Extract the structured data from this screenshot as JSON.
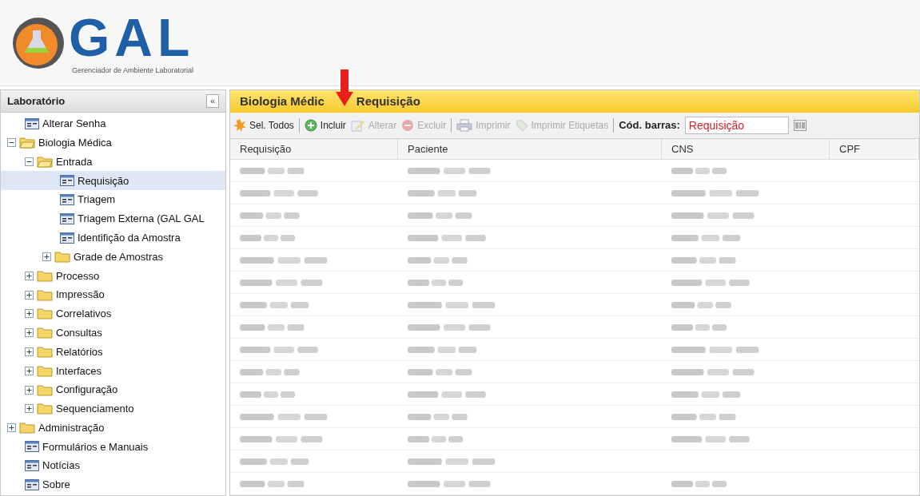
{
  "logo": {
    "name": "GAL",
    "subtitle": "Gerenciador de Ambiente Laboratorial"
  },
  "sidebar": {
    "title": "Laboratório",
    "collapse": "«",
    "items": [
      {
        "kind": "leaf",
        "label": "Alterar Senha",
        "selected": false
      },
      {
        "kind": "folder",
        "label": "Biologia Médica",
        "expanded": true,
        "children": [
          {
            "kind": "folder",
            "label": "Entrada",
            "expanded": true,
            "children": [
              {
                "kind": "leaf",
                "label": "Requisição",
                "selected": true
              },
              {
                "kind": "leaf",
                "label": "Triagem",
                "selected": false
              },
              {
                "kind": "leaf",
                "label": "Triagem Externa (GAL GAL",
                "selected": false
              },
              {
                "kind": "leaf",
                "label": "Identifição da Amostra",
                "selected": false
              },
              {
                "kind": "folder",
                "label": "Grade de Amostras",
                "expanded": false
              }
            ]
          },
          {
            "kind": "folder",
            "label": "Processo",
            "expanded": false
          },
          {
            "kind": "folder",
            "label": "Impressão",
            "expanded": false
          },
          {
            "kind": "folder",
            "label": "Correlativos",
            "expanded": false
          },
          {
            "kind": "folder",
            "label": "Consultas",
            "expanded": false
          },
          {
            "kind": "folder",
            "label": "Relatórios",
            "expanded": false
          },
          {
            "kind": "folder",
            "label": "Interfaces",
            "expanded": false
          },
          {
            "kind": "folder",
            "label": "Configuração",
            "expanded": false
          },
          {
            "kind": "folder",
            "label": "Sequenciamento",
            "expanded": false
          }
        ]
      },
      {
        "kind": "folder",
        "label": "Administração",
        "expanded": false
      },
      {
        "kind": "leaf",
        "label": "Formulários e Manuais",
        "selected": false
      },
      {
        "kind": "leaf",
        "label": "Notícias",
        "selected": false
      },
      {
        "kind": "leaf",
        "label": "Sobre",
        "selected": false
      }
    ]
  },
  "panel": {
    "title_parts": [
      "Biologia Médic",
      "Requisição"
    ],
    "toolbar": [
      {
        "kind": "select_all",
        "label": "Sel. Todos",
        "disabled": false
      },
      {
        "kind": "separator"
      },
      {
        "kind": "add",
        "label": "Incluir",
        "disabled": false
      },
      {
        "kind": "edit",
        "label": "Alterar",
        "disabled": true
      },
      {
        "kind": "delete",
        "label": "Excluir",
        "disabled": true
      },
      {
        "kind": "separator"
      },
      {
        "kind": "print",
        "label": "Imprimir",
        "disabled": true
      },
      {
        "kind": "labels",
        "label": "Imprimir Etiquetas",
        "disabled": true
      },
      {
        "kind": "separator"
      }
    ],
    "barcode": {
      "label": "Cód. barras:",
      "value": "Requisição"
    },
    "table": {
      "columns": [
        "Requisição",
        "Paciente",
        "CNS",
        "CPF"
      ],
      "rows": [
        {
          "cells": [
            {
              "kind": "obscured"
            },
            {
              "kind": "obscured"
            },
            {
              "kind": "obscured"
            }
          ]
        },
        {
          "cells": [
            {
              "kind": "obscured"
            },
            {
              "kind": "obscured"
            },
            {
              "kind": "obscured"
            }
          ]
        },
        {
          "cells": [
            {
              "kind": "obscured"
            },
            {
              "kind": "obscured"
            },
            {
              "kind": "obscured"
            }
          ]
        },
        {
          "cells": [
            {
              "kind": "obscured"
            },
            {
              "kind": "obscured"
            },
            {
              "kind": "obscured"
            }
          ]
        },
        {
          "cells": [
            {
              "kind": "obscured"
            },
            {
              "kind": "obscured"
            },
            {
              "kind": "obscured"
            }
          ]
        },
        {
          "cells": [
            {
              "kind": "obscured"
            },
            {
              "kind": "obscured"
            },
            {
              "kind": "obscured"
            }
          ]
        },
        {
          "cells": [
            {
              "kind": "obscured"
            },
            {
              "kind": "obscured"
            },
            {
              "kind": "obscured"
            }
          ]
        },
        {
          "cells": [
            {
              "kind": "obscured"
            },
            {
              "kind": "obscured"
            },
            {
              "kind": "obscured"
            }
          ]
        },
        {
          "cells": [
            {
              "kind": "obscured"
            },
            {
              "kind": "obscured"
            },
            {
              "kind": "obscured"
            }
          ]
        },
        {
          "cells": [
            {
              "kind": "obscured"
            },
            {
              "kind": "obscured"
            },
            {
              "kind": "obscured"
            }
          ]
        },
        {
          "cells": [
            {
              "kind": "obscured"
            },
            {
              "kind": "obscured"
            },
            {
              "kind": "obscured"
            }
          ]
        },
        {
          "cells": [
            {
              "kind": "obscured"
            },
            {
              "kind": "obscured"
            },
            {
              "kind": "obscured"
            }
          ]
        },
        {
          "cells": [
            {
              "kind": "obscured"
            },
            {
              "kind": "obscured"
            },
            {
              "kind": "obscured"
            }
          ]
        },
        {
          "cells": [
            {
              "kind": "obscured"
            },
            {
              "kind": "obscured"
            },
            {
              "kind": "empty"
            }
          ]
        },
        {
          "cells": [
            {
              "kind": "obscured"
            },
            {
              "kind": "obscured"
            },
            {
              "kind": "obscured"
            }
          ]
        }
      ]
    }
  },
  "annotation": {
    "kind": "arrow"
  }
}
